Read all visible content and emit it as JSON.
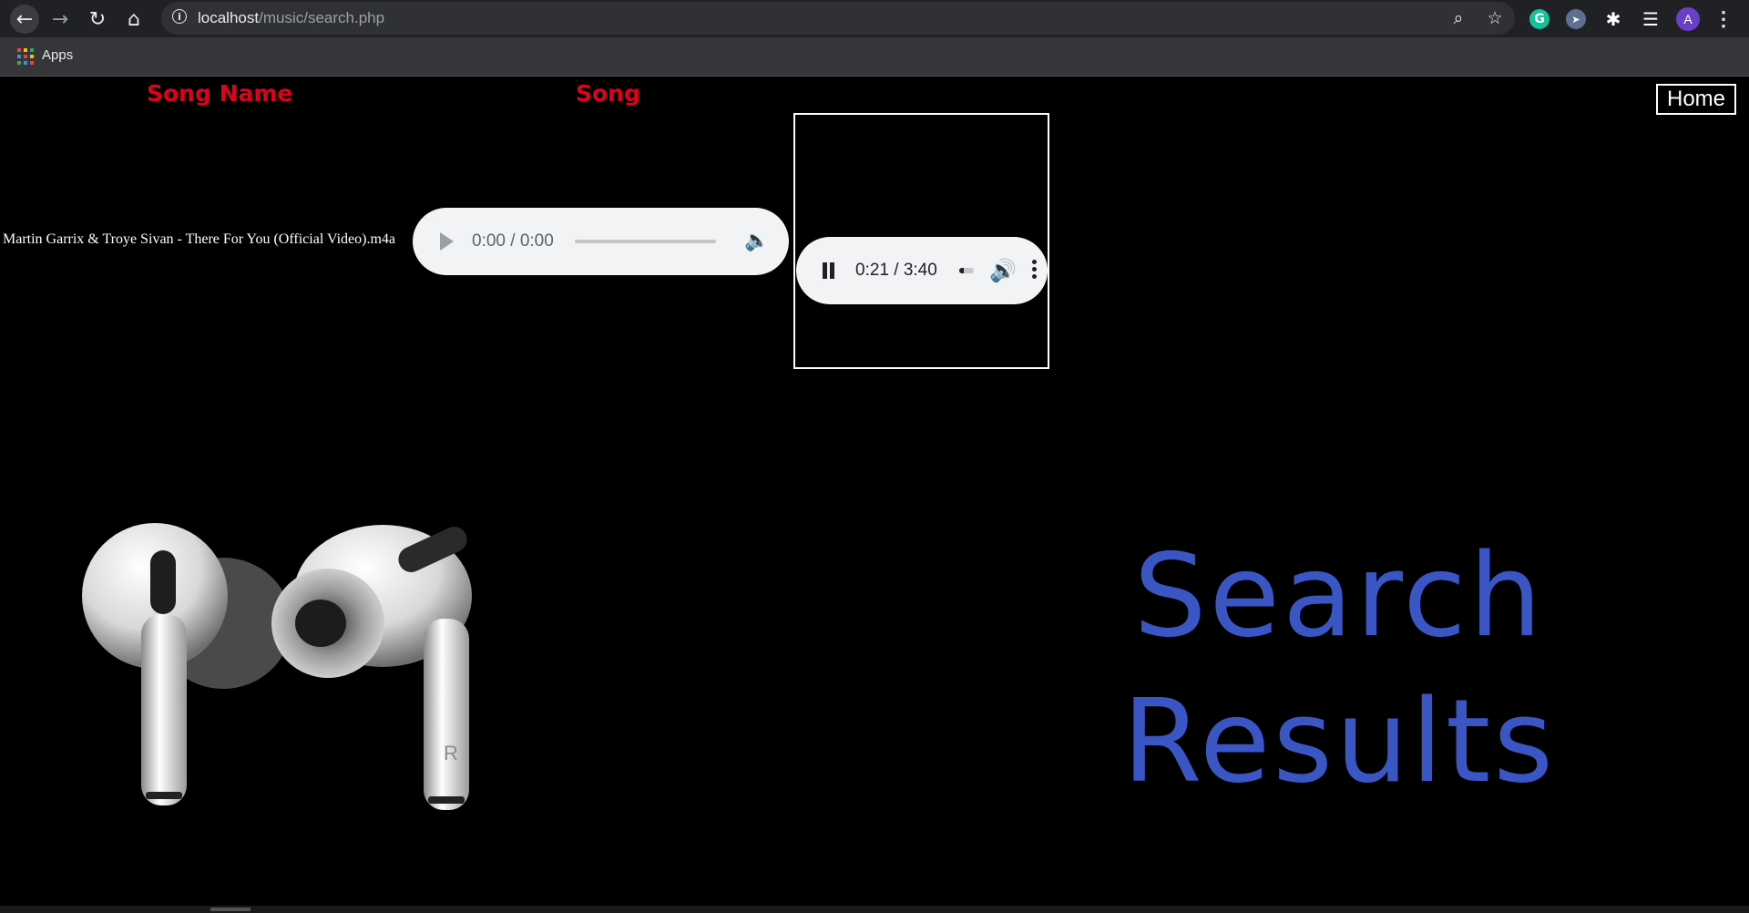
{
  "browser": {
    "url_host": "localhost",
    "url_path": "/music/search.php",
    "bookmarks": {
      "apps_label": "Apps"
    },
    "profile_initial": "A",
    "extensions": [
      "grammarly-icon",
      "cursor-icon",
      "puzzle-icon",
      "media-queue-icon"
    ]
  },
  "page": {
    "headers": {
      "song_name": "Song Name",
      "song": "Song"
    },
    "home_label": "Home",
    "results": [
      {
        "song_name": "Martin Garrix & Troye Sivan - There For You (Official Video).m4a",
        "player_time": "0:00 / 0:00"
      }
    ],
    "video_player": {
      "time": "0:21 / 3:40",
      "progress": 0.0955,
      "state": "playing"
    },
    "title_line1": "Search",
    "title_line2": "Results",
    "earbud_mark": "R"
  },
  "colors": {
    "header_red": "#e0001b",
    "title_blue": "#3a56c4",
    "background": "#000000"
  }
}
